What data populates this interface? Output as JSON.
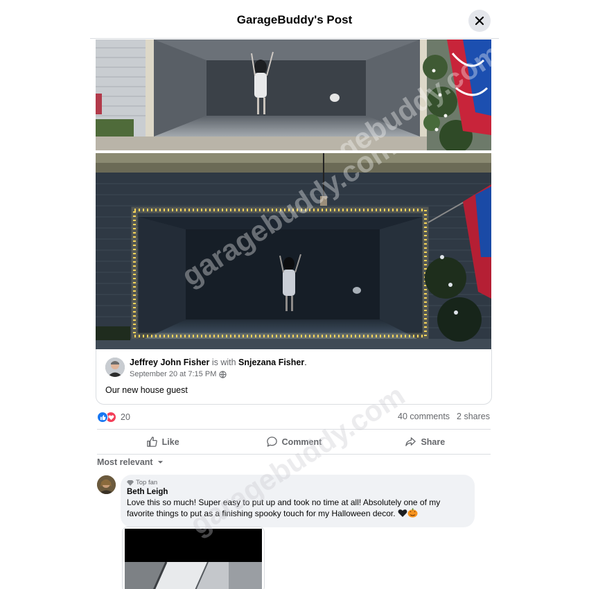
{
  "header": {
    "title": "GarageBuddy's Post"
  },
  "post": {
    "author": "Jeffrey John Fisher",
    "with_text": "is with",
    "tagged": "Snjezana Fisher",
    "period": ".",
    "date": "September 20 at 7:15 PM",
    "privacy_icon": "globe-icon",
    "text": "Our new house guest"
  },
  "reactions": {
    "icons": [
      "like-icon",
      "love-icon"
    ],
    "count": "20"
  },
  "stats": {
    "comments": "40 comments",
    "shares": "2 shares"
  },
  "actions": {
    "like": "Like",
    "comment": "Comment",
    "share": "Share"
  },
  "sort": {
    "label": "Most relevant"
  },
  "comment": {
    "badge": "Top fan",
    "name": "Beth Leigh",
    "text": "Love this so much! Super easy to put up and took no time at all! Absolutely one of my favorite things to put as a finishing spooky touch for my Halloween decor.",
    "emojis": [
      "black-heart-emoji",
      "jack-o-lantern-emoji"
    ]
  },
  "watermark": {
    "text": "garagebuddy.com"
  },
  "colors": {
    "accent": "#1877f2",
    "love": "#f33e58",
    "muted": "#65676b",
    "bubble": "#f0f2f5",
    "led": "#ffd84d"
  }
}
